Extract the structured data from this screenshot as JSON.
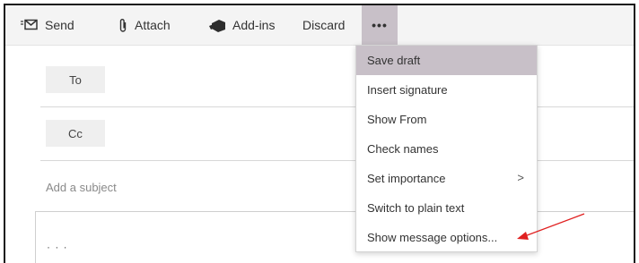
{
  "toolbar": {
    "send_label": "Send",
    "attach_label": "Attach",
    "addins_label": "Add-ins",
    "discard_label": "Discard",
    "more_label": "•••"
  },
  "recipients": {
    "to_label": "To",
    "cc_label": "Cc"
  },
  "subject": {
    "placeholder": "Add a subject"
  },
  "body": {
    "partial_text": "·  ·  ·"
  },
  "menu": {
    "items": [
      {
        "label": "Save draft",
        "highlighted": true
      },
      {
        "label": "Insert signature"
      },
      {
        "label": "Show From"
      },
      {
        "label": "Check names"
      },
      {
        "label": "Set importance",
        "submenu_indicator": ">"
      },
      {
        "label": "Switch to plain text"
      },
      {
        "label": "Show message options..."
      }
    ]
  },
  "annotation": {
    "arrow_color": "#e02020"
  },
  "colors": {
    "highlight": "#c8c0c8",
    "toolbar_bg": "#f4f4f4"
  }
}
